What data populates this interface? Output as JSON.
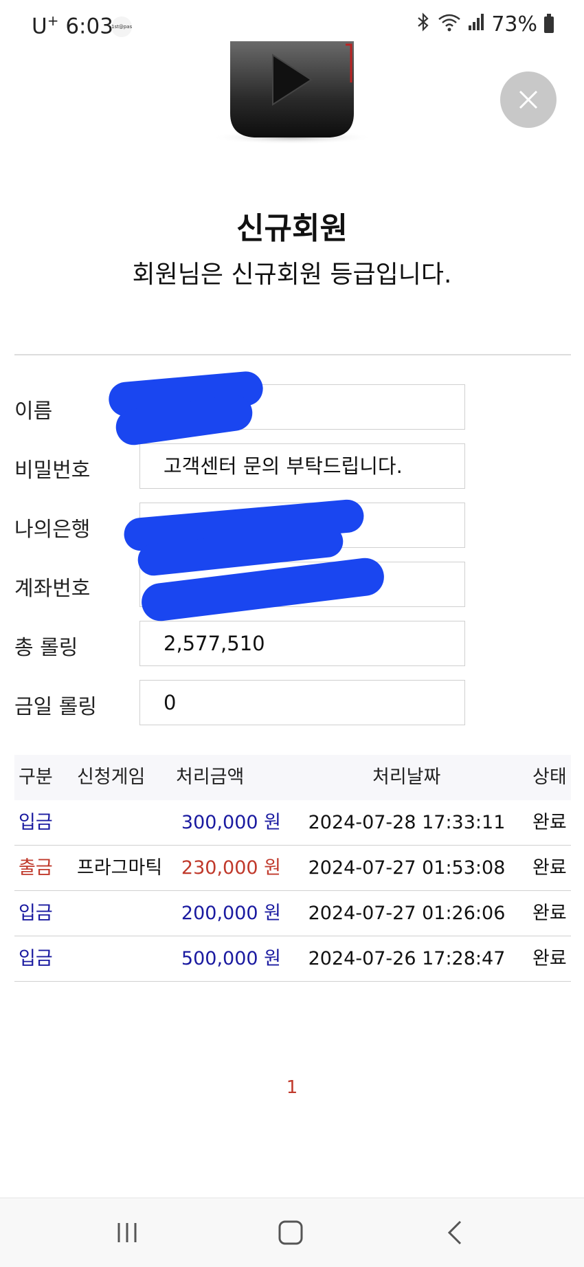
{
  "status_bar": {
    "carrier": "U",
    "carrier_mark": "+",
    "time": "6:03",
    "app_badge": "1st@pass",
    "bluetooth_icon": "bluetooth-icon",
    "wifi_icon": "wifi-icon",
    "signal_icon": "signal-icon",
    "battery": "73%"
  },
  "modal": {
    "close_icon": "close-icon",
    "grade_title": "신규회원",
    "grade_description": "회원님은 신규회원 등급입니다."
  },
  "profile": {
    "fields": [
      {
        "label": "이름",
        "value": ""
      },
      {
        "label": "비밀번호",
        "value": "고객센터 문의 부탁드립니다."
      },
      {
        "label": "나의은행",
        "value": ""
      },
      {
        "label": "계좌번호",
        "value": ""
      },
      {
        "label": "총 롤링",
        "value": "2,577,510"
      },
      {
        "label": "금일 롤링",
        "value": "0"
      }
    ]
  },
  "history": {
    "headers": [
      "구분",
      "신청게임",
      "처리금액",
      "처리날짜",
      "상태"
    ],
    "rows": [
      {
        "type": "입금",
        "game": "",
        "amount": "300,000 원",
        "date": "2024-07-28 17:33:11",
        "status": "완료"
      },
      {
        "type": "출금",
        "game": "프라그마틱",
        "amount": "230,000 원",
        "date": "2024-07-27 01:53:08",
        "status": "완료"
      },
      {
        "type": "입금",
        "game": "",
        "amount": "200,000 원",
        "date": "2024-07-27 01:26:06",
        "status": "완료"
      },
      {
        "type": "입금",
        "game": "",
        "amount": "500,000 원",
        "date": "2024-07-26 17:28:47",
        "status": "완료"
      }
    ],
    "colors": {
      "deposit": "#1a1aa0",
      "withdraw": "#c0392b"
    }
  },
  "pagination": {
    "current_page": "1"
  },
  "nav_bar": {
    "recents_icon": "recents-icon",
    "home_icon": "home-icon",
    "back_icon": "back-icon"
  }
}
